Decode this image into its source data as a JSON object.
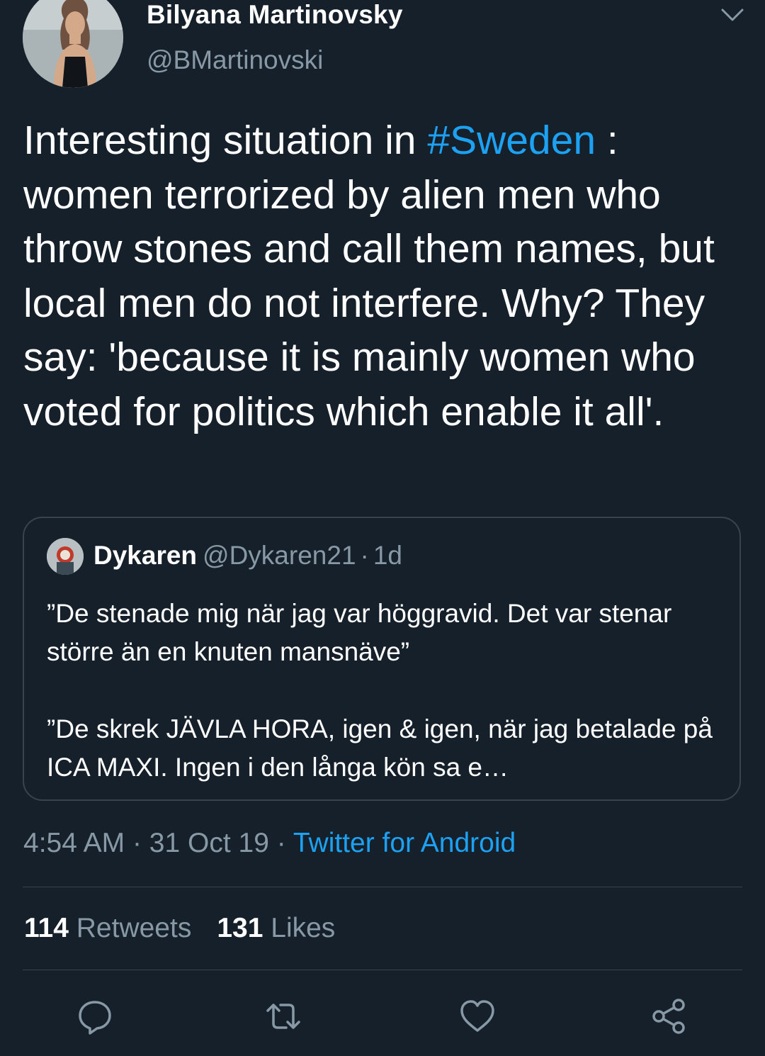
{
  "tweet": {
    "author": {
      "name": "Bilyana Martinovsky",
      "handle": "@BMartinovski"
    },
    "text": {
      "before_hashtag": "Interesting situation in ",
      "hashtag": "#Sweden",
      "after_hashtag": " : women terrorized by alien men who throw stones and call them names, but local men do not interfere. Why? They say: 'because it is mainly women who voted for politics which enable it all'."
    },
    "quoted": {
      "name": "Dykaren",
      "handle": "@Dykaren21",
      "separator": "·",
      "time": "1d",
      "paragraph_1": "”De stenade mig när jag var höggravid. Det var stenar större än en knuten mansnäve”",
      "paragraph_2": "”De skrek JÄVLA HORA, igen & igen, när jag betalade på ICA MAXI. Ingen i den långa kön sa e…"
    },
    "meta": {
      "time": "4:54 AM",
      "sep1": "·",
      "date": "31 Oct 19",
      "sep2": "·",
      "source": "Twitter for Android"
    },
    "stats": {
      "retweets_count": "114",
      "retweets_label": "Retweets",
      "likes_count": "131",
      "likes_label": "Likes"
    }
  },
  "actions": {
    "reply_icon": "reply-icon",
    "retweet_icon": "retweet-icon",
    "like_icon": "heart-icon",
    "share_icon": "share-icon"
  },
  "colors": {
    "background": "#15202b",
    "text_primary": "#ffffff",
    "text_secondary": "#8899a6",
    "accent": "#1da1f2",
    "border": "#38444d"
  }
}
